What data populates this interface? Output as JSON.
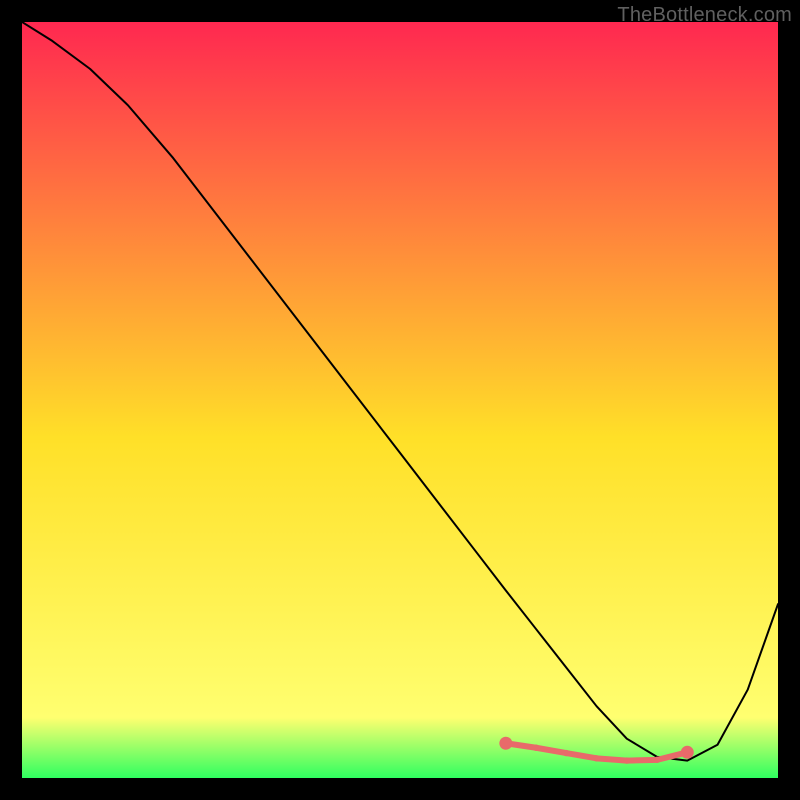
{
  "attribution": "TheBottleneck.com",
  "chart_data": {
    "type": "line",
    "title": "",
    "xlabel": "",
    "ylabel": "",
    "xlim": [
      0,
      100
    ],
    "ylim": [
      0,
      100
    ],
    "background_gradient": {
      "top_color_pct": 0,
      "top_color": "#ff2850",
      "mid_color_pct": 55,
      "mid_color": "#ffe028",
      "low_color_pct": 92,
      "low_color": "#ffff70",
      "bottom_color_pct": 100,
      "bottom_color": "#2fff60"
    },
    "x": [
      0,
      4,
      9,
      14,
      20,
      30,
      40,
      50,
      60,
      64,
      68,
      72,
      76,
      80,
      84,
      88,
      92,
      96,
      100
    ],
    "values": [
      100,
      97.5,
      93.8,
      89,
      82,
      69,
      56,
      43,
      30,
      24.8,
      19.7,
      14.6,
      9.5,
      5.2,
      2.8,
      2.3,
      4.4,
      11.7,
      23
    ],
    "highlight_band": {
      "x": [
        64,
        68,
        72,
        76,
        80,
        84,
        88
      ],
      "values": [
        4.6,
        4.0,
        3.3,
        2.6,
        2.3,
        2.4,
        3.4
      ],
      "color": "#e86a6a",
      "stroke_width": 6
    },
    "main_line": {
      "color": "#000000",
      "stroke_width": 2
    }
  }
}
